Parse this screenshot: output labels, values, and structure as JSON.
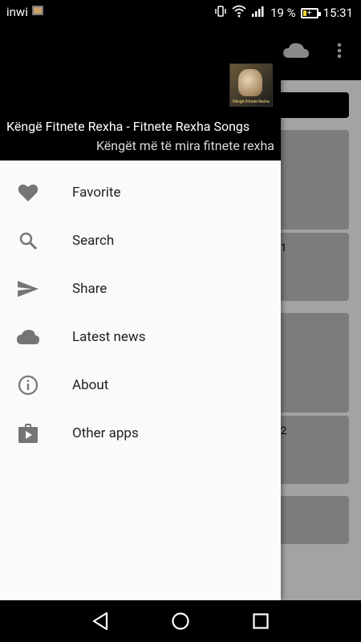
{
  "status_bar": {
    "carrier": "inwi",
    "battery_percent": "19 %",
    "time": "15:31"
  },
  "drawer": {
    "header": {
      "thumbnail_caption": "Këngë Fitnete Rexha",
      "title": "Këngë Fitnete Rexha - Fitnete Rexha Songs",
      "subtitle": "Këngët më të mira fitnete rexha"
    },
    "items": [
      {
        "label": "Favorite",
        "icon": "heart-icon"
      },
      {
        "label": "Search",
        "icon": "search-icon"
      },
      {
        "label": "Share",
        "icon": "send-icon"
      },
      {
        "label": "Latest news",
        "icon": "cloud-icon"
      },
      {
        "label": "About",
        "icon": "info-icon"
      },
      {
        "label": "Other apps",
        "icon": "store-icon"
      }
    ]
  },
  "background": {
    "peek_1": "/",
    "peek_2": "1",
    "peek_3": "/",
    "peek_4": "2"
  },
  "colors": {
    "drawer_bg": "#fafafa",
    "header_bg": "#000000",
    "icon_gray": "#757575",
    "scrim_bg": "#a3a3a3"
  }
}
